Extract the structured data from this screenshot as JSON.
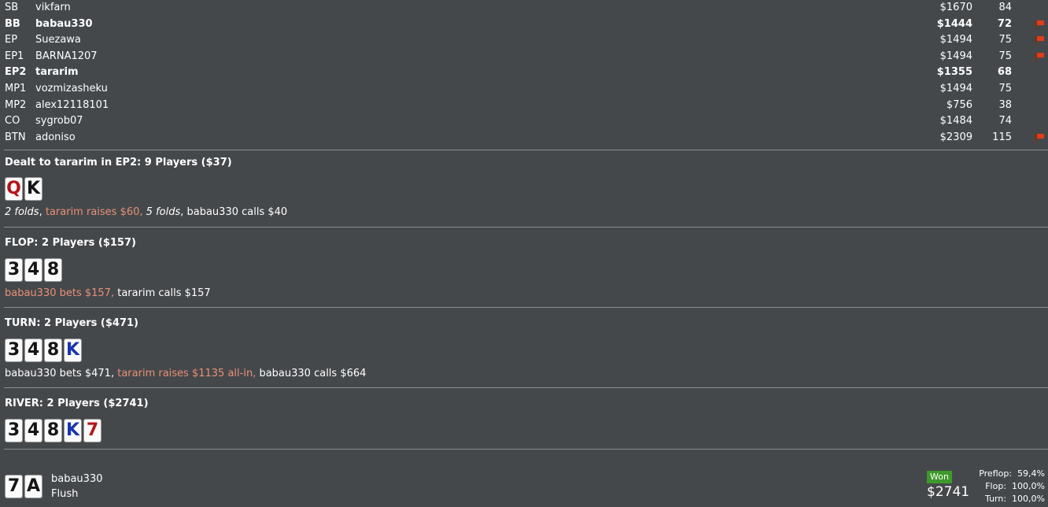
{
  "players": [
    {
      "pos": "SB",
      "name": "vikfarn",
      "stack": "$1670",
      "bb": "84",
      "bold": false,
      "flag": false
    },
    {
      "pos": "BB",
      "name": "babau330",
      "stack": "$1444",
      "bb": "72",
      "bold": true,
      "flag": true
    },
    {
      "pos": "EP",
      "name": "Suezawa",
      "stack": "$1494",
      "bb": "75",
      "bold": false,
      "flag": true
    },
    {
      "pos": "EP1",
      "name": "BARNA1207",
      "stack": "$1494",
      "bb": "75",
      "bold": false,
      "flag": true
    },
    {
      "pos": "EP2",
      "name": "tararim",
      "stack": "$1355",
      "bb": "68",
      "bold": true,
      "flag": false
    },
    {
      "pos": "MP1",
      "name": "vozmizasheku",
      "stack": "$1494",
      "bb": "75",
      "bold": false,
      "flag": false
    },
    {
      "pos": "MP2",
      "name": "alex12118101",
      "stack": "$756",
      "bb": "38",
      "bold": false,
      "flag": false
    },
    {
      "pos": "CO",
      "name": "sygrob07",
      "stack": "$1484",
      "bb": "74",
      "bold": false,
      "flag": false
    },
    {
      "pos": "BTN",
      "name": "adoniso",
      "stack": "$2309",
      "bb": "115",
      "bold": false,
      "flag": true
    }
  ],
  "preflop": {
    "title": "Dealt to tararim in EP2: 9 Players ($37)",
    "cards": [
      {
        "rank": "Q",
        "color": "red"
      },
      {
        "rank": "K",
        "color": "black"
      }
    ],
    "actions": [
      {
        "text": "2 folds",
        "style": "fold",
        "sep": ", "
      },
      {
        "text": "tararim raises $60,",
        "style": "hero",
        "sep": " "
      },
      {
        "text": "5 folds",
        "style": "fold",
        "sep": ", "
      },
      {
        "text": "babau330 calls $40",
        "style": "normal",
        "sep": ""
      }
    ]
  },
  "flop": {
    "title": "FLOP: 2 Players ($157)",
    "cards": [
      {
        "rank": "3",
        "color": "black"
      },
      {
        "rank": "4",
        "color": "black"
      },
      {
        "rank": "8",
        "color": "black"
      }
    ],
    "actions": [
      {
        "text": "babau330 bets $157,",
        "style": "hero",
        "sep": " "
      },
      {
        "text": "tararim calls $157",
        "style": "normal",
        "sep": ""
      }
    ]
  },
  "turn": {
    "title": "TURN: 2 Players ($471)",
    "cards": [
      {
        "rank": "3",
        "color": "black"
      },
      {
        "rank": "4",
        "color": "black"
      },
      {
        "rank": "8",
        "color": "black"
      },
      {
        "rank": "K",
        "color": "blue"
      }
    ],
    "actions": [
      {
        "text": "babau330 bets $471,",
        "style": "normal",
        "sep": " "
      },
      {
        "text": "tararim raises $1135 all-in,",
        "style": "hero",
        "sep": " "
      },
      {
        "text": "babau330 calls $664",
        "style": "normal",
        "sep": ""
      }
    ]
  },
  "river": {
    "title": "RIVER: 2 Players ($2741)",
    "cards": [
      {
        "rank": "3",
        "color": "black"
      },
      {
        "rank": "4",
        "color": "black"
      },
      {
        "rank": "8",
        "color": "black"
      },
      {
        "rank": "K",
        "color": "blue"
      },
      {
        "rank": "7",
        "color": "red"
      }
    ]
  },
  "showdown": {
    "cards": [
      {
        "rank": "7",
        "color": "black"
      },
      {
        "rank": "A",
        "color": "black"
      }
    ],
    "player": "babau330",
    "hand": "Flush",
    "won_label": "Won",
    "won_amount": "$2741",
    "equity": [
      {
        "label": "Preflop:",
        "value": "59,4%"
      },
      {
        "label": "Flop:",
        "value": "100,0%"
      },
      {
        "label": "Turn:",
        "value": "100,0%"
      }
    ]
  },
  "colors": {
    "background": "#45484b",
    "hero_action": "#e89078",
    "won_badge": "#3c9a2a",
    "flag": "#e23c1c"
  }
}
